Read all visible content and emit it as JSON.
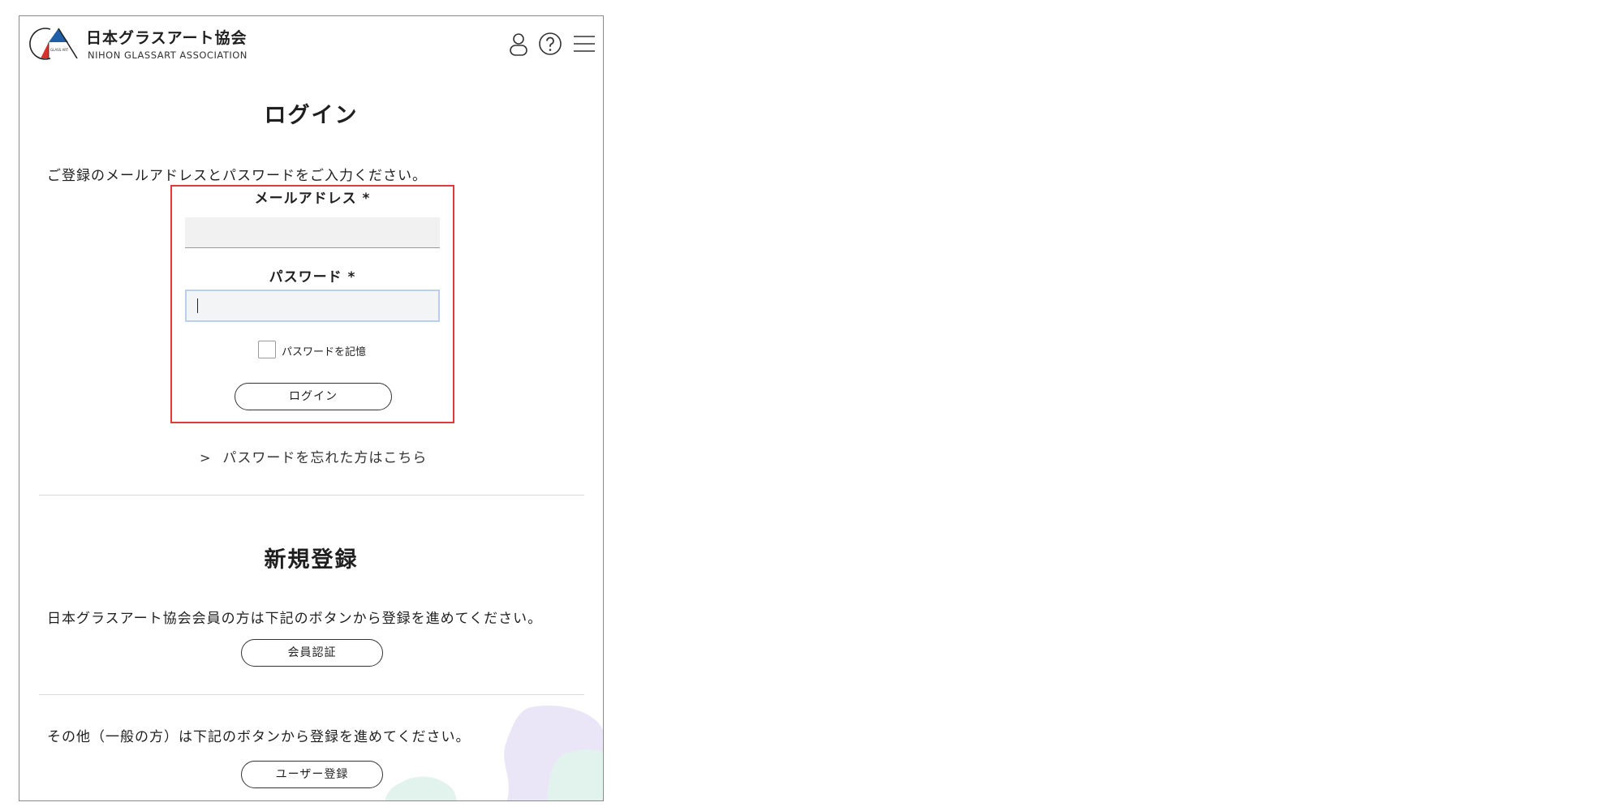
{
  "header": {
    "brand_jp": "日本グラスアート協会",
    "brand_en": "NIHON GLASSART ASSOCIATION",
    "logo_small_text": "GLASS ART",
    "icons": [
      "user-icon",
      "help-icon",
      "menu-icon"
    ]
  },
  "login": {
    "title": "ログイン",
    "instruction": "ご登録のメールアドレスとパスワードをご入力ください。",
    "email_label": "メールアドレス *",
    "email_value": "",
    "password_label": "パスワード *",
    "password_value": "",
    "remember_label": "パスワードを記憶",
    "remember_checked": false,
    "button_label": "ログイン",
    "forgot_chevron": ">",
    "forgot_link": "パスワードを忘れた方はこちら"
  },
  "register": {
    "title": "新規登録",
    "member_text": "日本グラスアート協会会員の方は下記のボタンから登録を進めてください。",
    "member_button": "会員認証",
    "general_text": "その他（一般の方）は下記のボタンから登録を進めてください。",
    "general_button": "ユーザー登録"
  },
  "colors": {
    "highlight_border": "#e03a3a",
    "logo_blue": "#1f5fa8",
    "logo_red": "#d8322c",
    "deco_lavender": "#ebe6f7",
    "deco_mint": "#e2f3ee"
  }
}
